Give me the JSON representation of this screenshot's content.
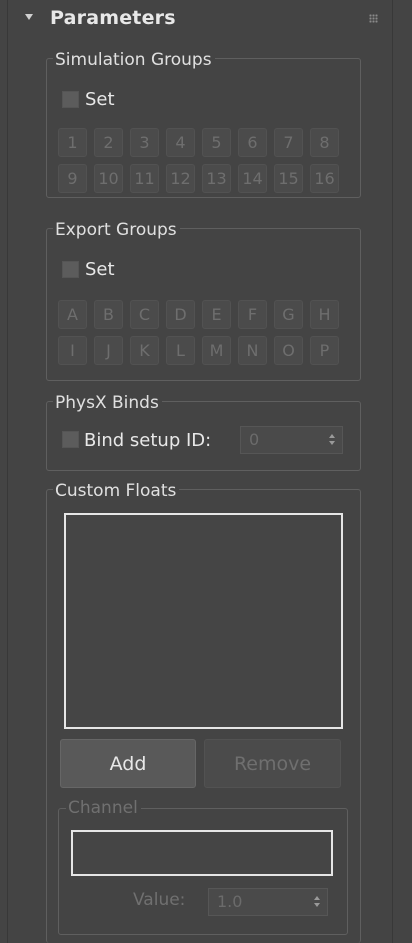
{
  "rollout": {
    "title": "Parameters"
  },
  "simulation_groups": {
    "label": "Simulation Groups",
    "set_label": "Set",
    "buttons": [
      "1",
      "2",
      "3",
      "4",
      "5",
      "6",
      "7",
      "8",
      "9",
      "10",
      "11",
      "12",
      "13",
      "14",
      "15",
      "16"
    ]
  },
  "export_groups": {
    "label": "Export Groups",
    "set_label": "Set",
    "buttons": [
      "A",
      "B",
      "C",
      "D",
      "E",
      "F",
      "G",
      "H",
      "I",
      "J",
      "K",
      "L",
      "M",
      "N",
      "O",
      "P"
    ]
  },
  "physx_binds": {
    "label": "PhysX Binds",
    "bind_label": "Bind setup ID:",
    "bind_value": "0"
  },
  "custom_floats": {
    "label": "Custom Floats",
    "add_label": "Add",
    "remove_label": "Remove",
    "channel": {
      "label": "Channel",
      "name_value": "",
      "value_label": "Value:",
      "value": "1.0"
    }
  },
  "colors": {
    "background": "#444444",
    "disabled_text": "#6e6e6e",
    "text": "#e0e0e0",
    "focus_border": "#e6e6e6"
  }
}
